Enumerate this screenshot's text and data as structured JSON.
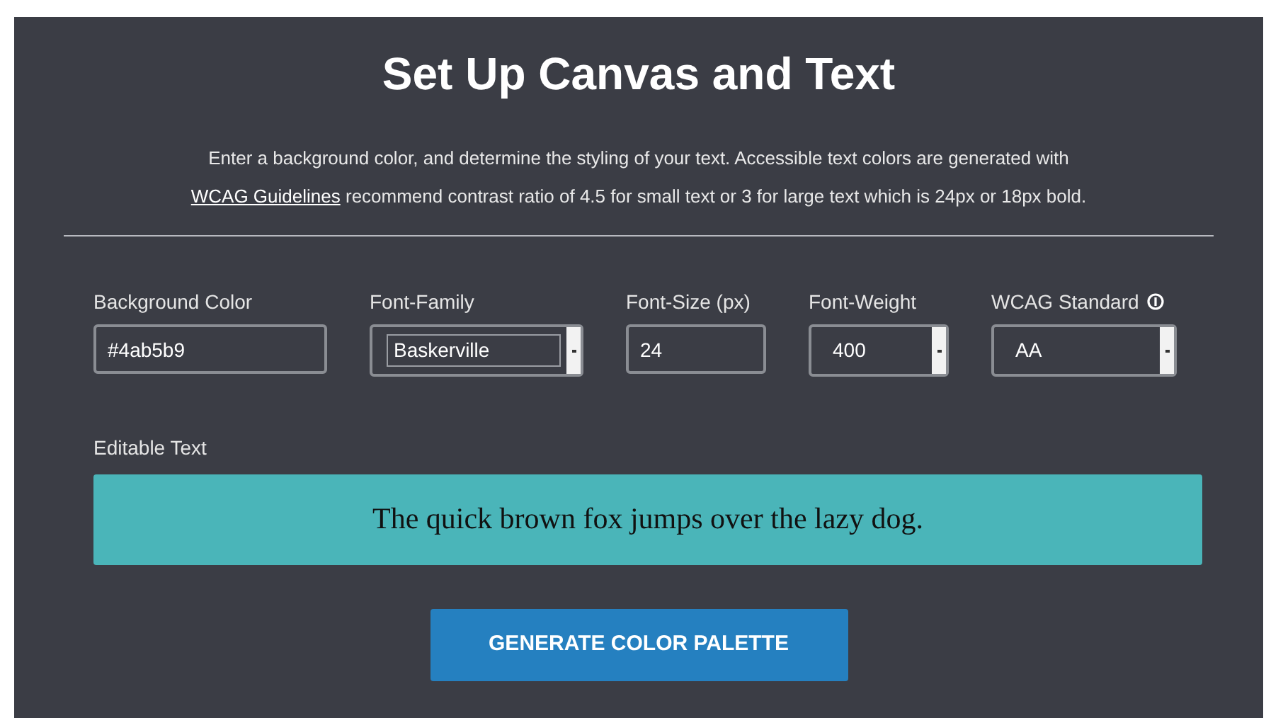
{
  "title": "Set Up Canvas and Text",
  "description": {
    "link": "WCAG Guidelines",
    "before": "Enter a background color, and determine the styling of your text. Accessible text colors are generated with",
    "after": "recommend contrast ratio of 4.5 for small text or 3 for large text which is 24px or 18px bold."
  },
  "fields": [
    {
      "kind": "text",
      "label": "Background Color",
      "value": "#4ab5b9"
    },
    {
      "kind": "select",
      "label": "Font-Family",
      "value": "Baskerville",
      "focused": true
    },
    {
      "kind": "text",
      "label": "Font-Size (px)",
      "value": "24"
    },
    {
      "kind": "select",
      "label": "Font-Weight",
      "value": "400",
      "focused": false
    },
    {
      "kind": "select",
      "label": "WCAG Standard",
      "value": "AA",
      "focused": false,
      "info": true
    }
  ],
  "editable_text": {
    "label": "Editable Text",
    "text": "The quick brown fox jumps over the lazy dog.",
    "color": "#4ab5b9"
  },
  "button": "GENERATE COLOR PALETTE"
}
